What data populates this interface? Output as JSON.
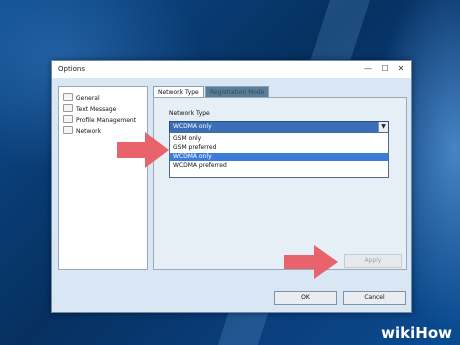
{
  "window": {
    "title": "Options",
    "minimize_glyph": "—",
    "maximize_glyph": "☐",
    "close_glyph": "✕"
  },
  "sidebar": {
    "items": [
      {
        "label": "General",
        "icon": "folder-icon"
      },
      {
        "label": "Text Message",
        "icon": "folder-icon"
      },
      {
        "label": "Profile Management",
        "icon": "folder-icon"
      },
      {
        "label": "Network",
        "icon": "folder-icon"
      }
    ]
  },
  "tabs": [
    {
      "label": "Network Type",
      "active": true
    },
    {
      "label": "Registration Mode",
      "active": false
    }
  ],
  "network": {
    "group_label": "Network Type",
    "selected_value": "WCDMA only",
    "dropdown_arrow": "▼",
    "options": [
      "GSM only",
      "GSM preferred",
      "WCDMA only",
      "WCDMA preferred"
    ],
    "highlighted_option": "WCDMA only"
  },
  "buttons": {
    "apply": "Apply",
    "ok": "OK",
    "cancel": "Cancel"
  },
  "annotations": {
    "arrow_color": "#e8636b"
  },
  "watermark": {
    "text": "wikiHow"
  }
}
